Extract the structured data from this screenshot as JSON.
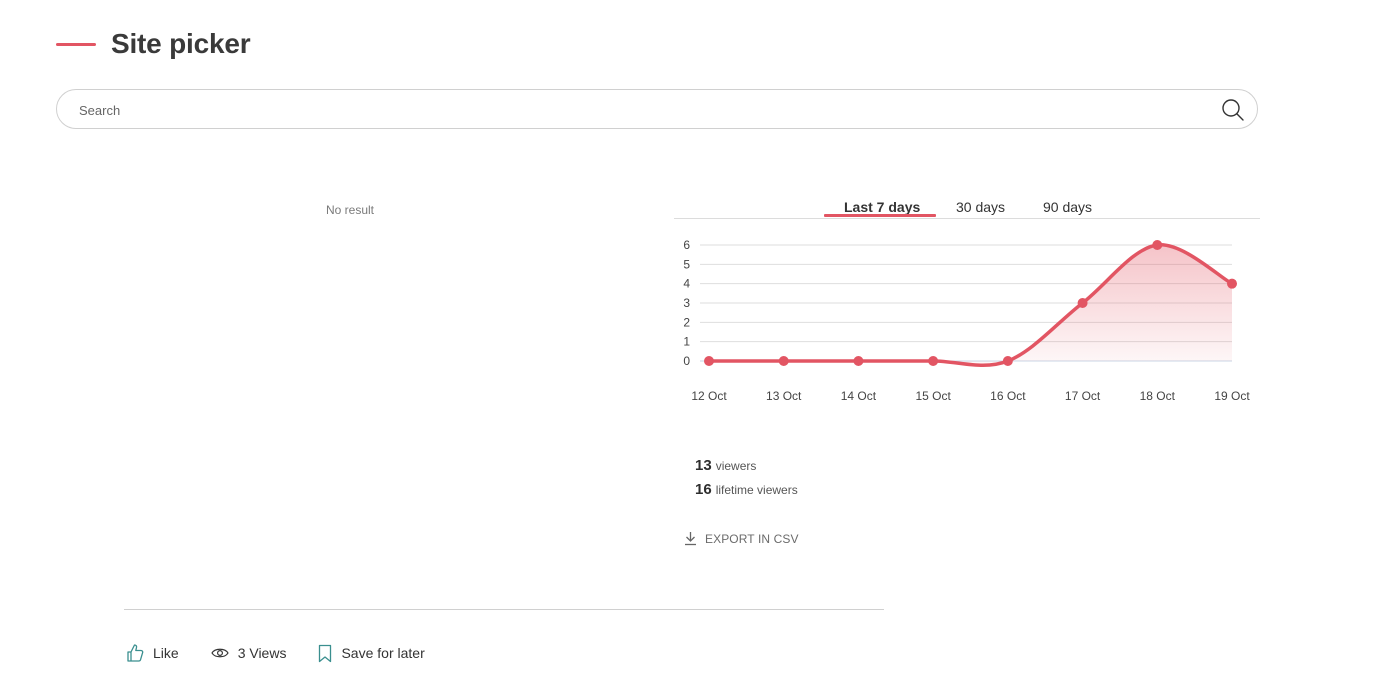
{
  "page": {
    "title": "Site picker",
    "accent_color": "#e25563"
  },
  "search": {
    "placeholder": "Search",
    "value": ""
  },
  "results": {
    "empty_text": "No result"
  },
  "tabs": [
    {
      "label": "Last 7 days",
      "active": true
    },
    {
      "label": "30 days",
      "active": false
    },
    {
      "label": "90 days",
      "active": false
    }
  ],
  "chart_data": {
    "type": "area",
    "categories": [
      "12 Oct",
      "13 Oct",
      "14 Oct",
      "15 Oct",
      "16 Oct",
      "17 Oct",
      "18 Oct",
      "19 Oct"
    ],
    "series": [
      {
        "values": [
          0,
          0,
          0,
          0,
          0,
          3,
          6,
          4
        ]
      }
    ],
    "ylim": [
      0,
      6
    ],
    "yticks": [
      0,
      1,
      2,
      3,
      4,
      5,
      6
    ],
    "grid": true,
    "line_color": "#e25563"
  },
  "stats": {
    "viewers_count": "13",
    "viewers_label": "viewers",
    "lifetime_count": "16",
    "lifetime_label": "lifetime viewers"
  },
  "export": {
    "label": "EXPORT IN CSV",
    "icon": "download-icon"
  },
  "actions": [
    {
      "label": "Like",
      "icon": "thumbs-up-icon"
    },
    {
      "label": "3 Views",
      "icon": "eye-icon"
    },
    {
      "label": "Save for later",
      "icon": "bookmark-icon"
    }
  ]
}
